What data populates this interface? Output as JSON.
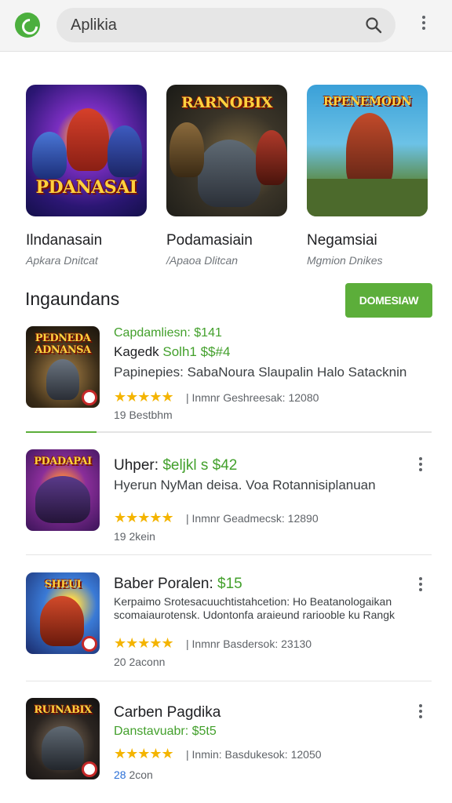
{
  "header": {
    "search_text": "Aplikia",
    "logo_icon": "app-logo-icon",
    "search_icon": "search-icon",
    "menu_icon": "more-vert-icon"
  },
  "featured": [
    {
      "art_title": "PDANASAI",
      "name": "Ilndanasain",
      "subtitle": "Apkara Dnitcat"
    },
    {
      "art_title": "RARNOBIX",
      "name": "Podamasiain",
      "subtitle": "/Apaoa Dlitcan"
    },
    {
      "art_title": "RPENEMODN",
      "name": "Negamsiai",
      "subtitle": "Mgmion Dnikes"
    }
  ],
  "section": {
    "title": "Ingaundans",
    "button_label": "DOMESIAW"
  },
  "list": [
    {
      "art_title": "PEDNEDA ADNANSA",
      "title": "",
      "line1": "Capdamliesn: $141",
      "line2_a": "Kagedk ",
      "line2_b": "Solh1 $$#4",
      "desc": "Papinepies: SabaNoura Slaupalin Halo Satacknin",
      "stars": "★★★★★",
      "meta": "| Inmnr Geshreesak:  12080",
      "small": "19   Bestbhm"
    },
    {
      "art_title": "PDADAPAI",
      "title_a": "Uhper: ",
      "title_b": "$eljkl s $42",
      "desc": "Hyerun NyMan deisa. Voa Rotannisiplanuan",
      "stars": "★★★★★",
      "meta": "| Inmnr Geadmecsk:  12890",
      "small": "19   2kein"
    },
    {
      "art_title": "SHEUI",
      "title_a": "Baber Poralen: ",
      "title_b": "$15",
      "desc": "Kerpaimo Srotesacuuchtistahcetion: Ho Beatanologaikan scomaiaurotensk. Udontonfa araieund rariooble ku Rangk",
      "stars": "★★★★★",
      "meta": "| Inmnr Basdersok:  23130",
      "small": "20   2aconn"
    },
    {
      "art_title": "RUINABIX",
      "title": "Carben Pagdika",
      "line1": "Danstavuabr: $5t5",
      "stars": "★★★★★",
      "meta": "| Inmin: Basdukesok:  12050",
      "small_a": "28",
      "small_b": "   2con"
    }
  ]
}
